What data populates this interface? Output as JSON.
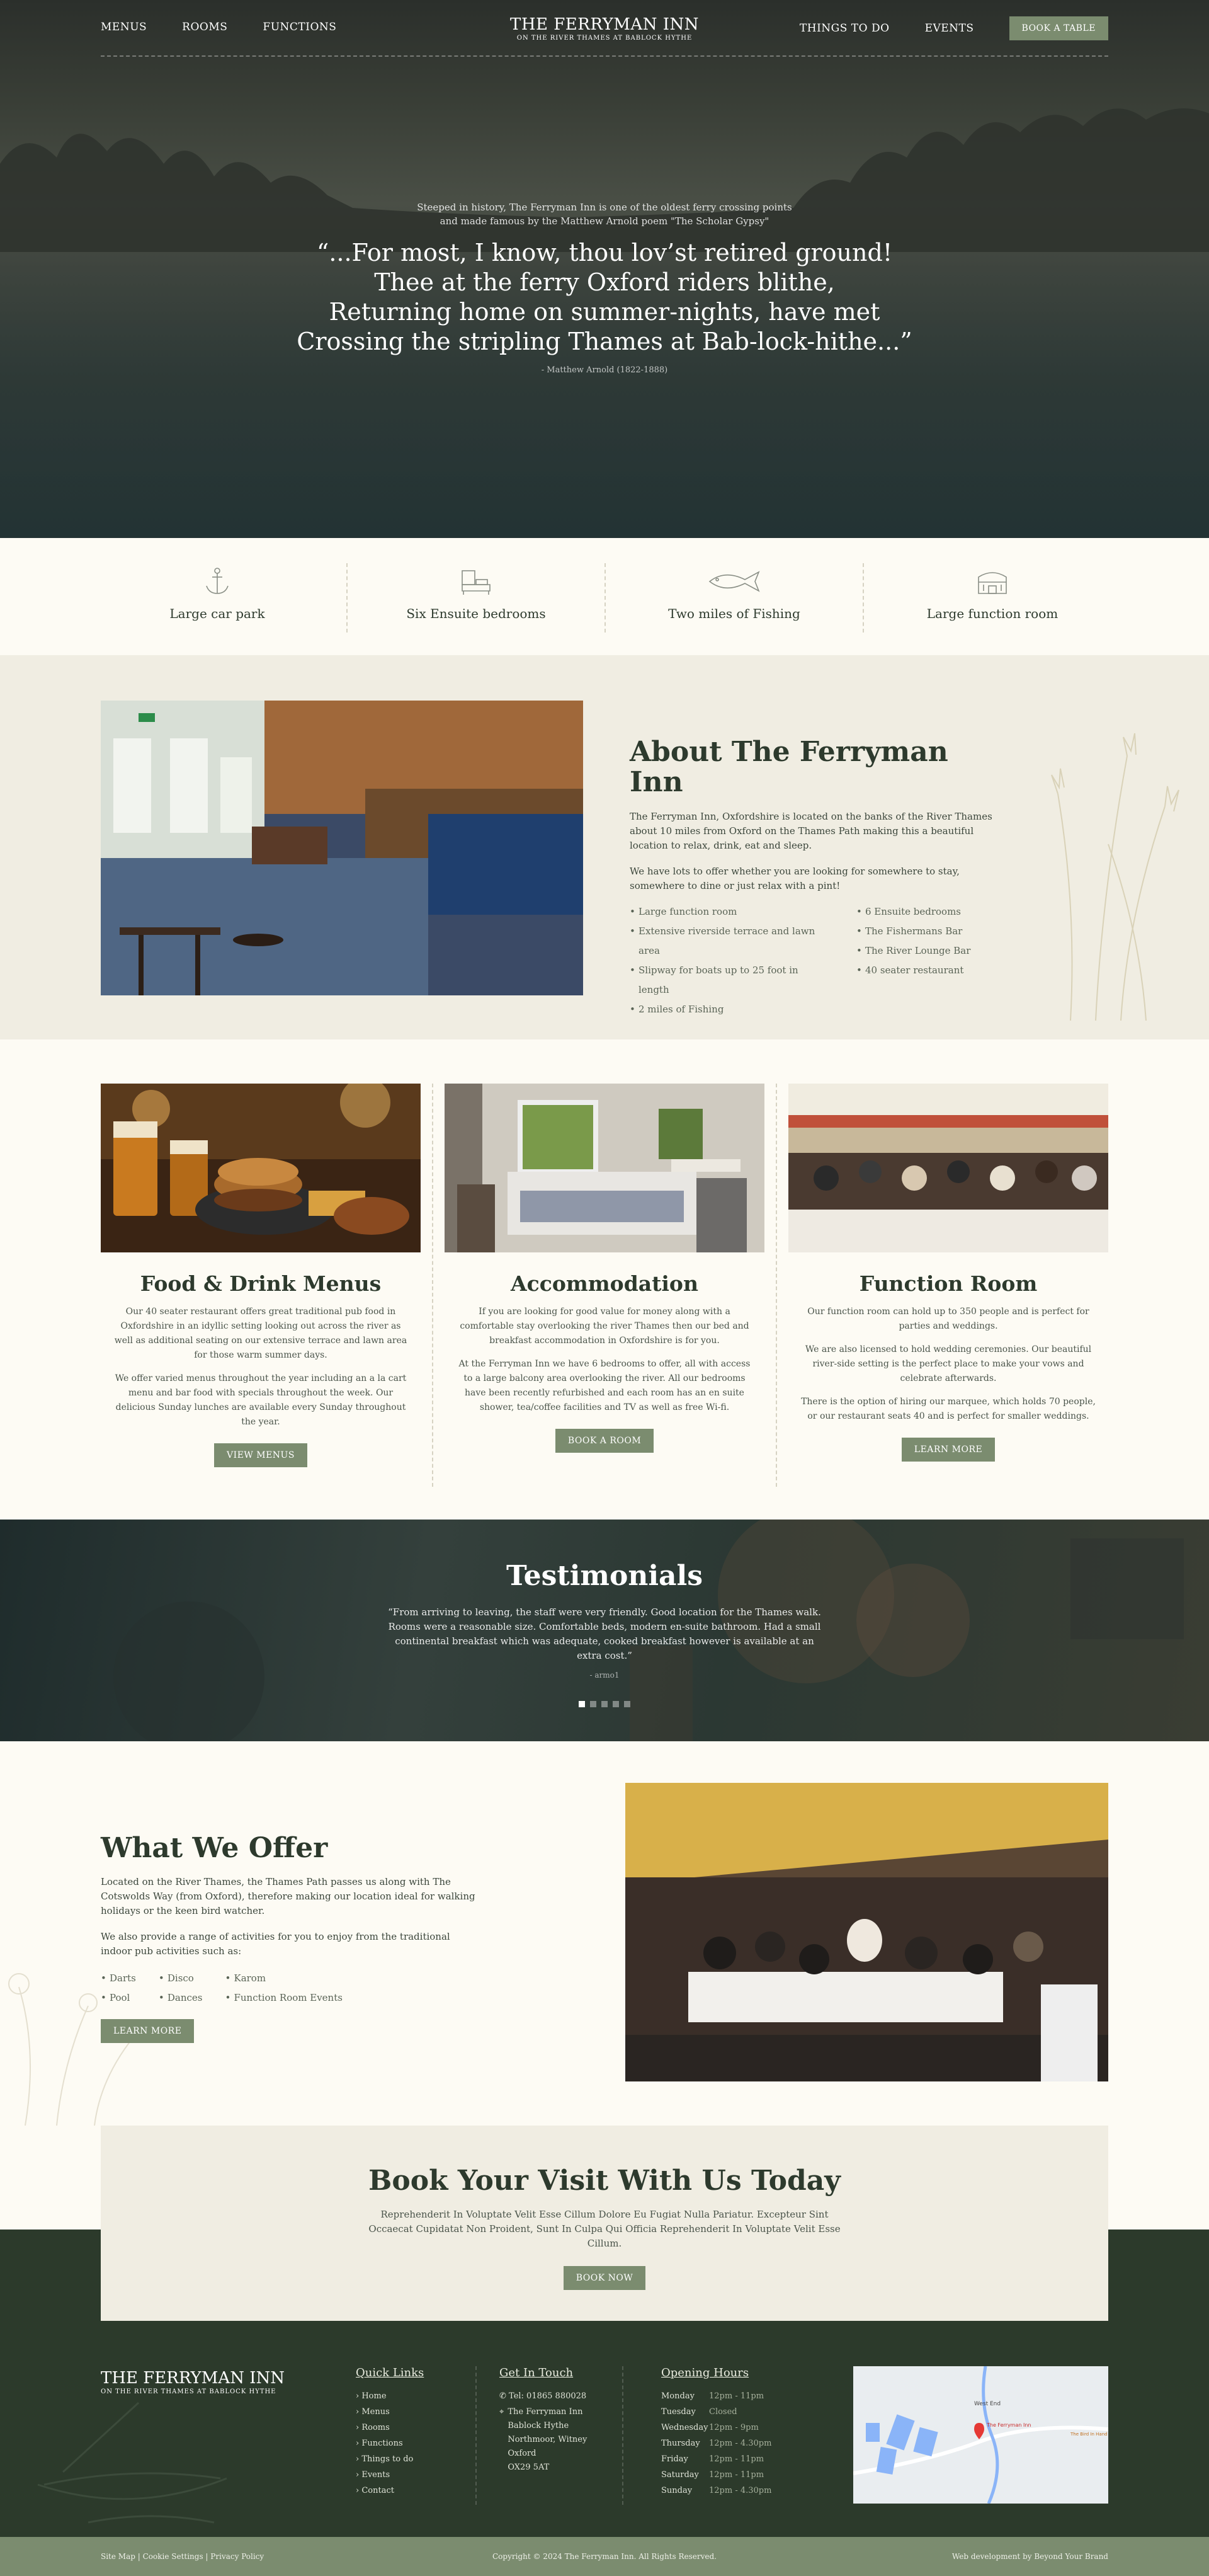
{
  "nav": {
    "left": [
      "MENUS",
      "ROOMS",
      "FUNCTIONS"
    ],
    "right": [
      "THINGS TO DO",
      "EVENTS"
    ],
    "book_button": "BOOK A TABLE",
    "logo_name": "THE FERRYMAN INN",
    "logo_sub": "ON THE RIVER THAMES AT BABLOCK HYTHE"
  },
  "hero": {
    "intro": "Steeped in history, The Ferryman Inn is one of the oldest ferry crossing points and made famous by the Matthew Arnold poem \"The Scholar Gypsy\"",
    "quote_lines": [
      "“...For most, I know, thou lov’st retired ground!",
      "Thee at the ferry Oxford riders blithe,",
      "Returning home on summer-nights, have met",
      "Crossing the stripling Thames at Bab-lock-hithe...”"
    ],
    "cite": "- Matthew Arnold (1822-1888)"
  },
  "features": [
    {
      "label": "Large car park",
      "icon": "anchor-icon"
    },
    {
      "label": "Six Ensuite bedrooms",
      "icon": "bed-icon"
    },
    {
      "label": "Two miles of Fishing",
      "icon": "fish-icon"
    },
    {
      "label": "Large function room",
      "icon": "building-icon"
    }
  ],
  "about": {
    "title": "About The Ferryman Inn",
    "p1": "The Ferryman Inn, Oxfordshire is located on the banks of the River Thames about 10 miles from Oxford on the Thames Path making this a beautiful location to relax, drink, eat and sleep.",
    "p2": "We have lots to offer whether you are looking for somewhere to stay, somewhere to dine or just relax with a pint!",
    "list_left": [
      "Large function room",
      "Extensive riverside terrace and lawn area",
      "Slipway for boats up to 25 foot in length",
      "2 miles of Fishing"
    ],
    "list_right": [
      "6 Ensuite bedrooms",
      "The Fishermans Bar",
      "The River Lounge Bar",
      "40 seater restaurant"
    ]
  },
  "cards": [
    {
      "title": "Food & Drink Menus",
      "p1": "Our 40 seater restaurant offers great traditional pub food in Oxfordshire in an idyllic setting looking out across the river as well as additional seating on our extensive terrace and lawn area for those warm summer days.",
      "p2": "We offer varied menus throughout the year including an a la cart menu and bar food with specials throughout the week. Our delicious Sunday lunches are available every Sunday throughout the year.",
      "button": "VIEW MENUS"
    },
    {
      "title": "Accommodation",
      "p1": "If you are looking for good value for money along with a comfortable stay overlooking the river Thames then our bed and breakfast accommodation in Oxfordshire is for you.",
      "p2": "At the Ferryman Inn we have 6 bedrooms to offer, all with access to a large balcony area overlooking the river. All our bedrooms have been recently refurbished and each room has an en  suite shower, tea/coffee facilities and TV as well as free Wi-fi.",
      "button": "BOOK A ROOM"
    },
    {
      "title": "Function Room",
      "p1": "Our function room can hold up to 350 people and is perfect for parties and weddings.",
      "p2": "We are also licensed to hold wedding ceremonies. Our beautiful river-side setting is the perfect place to make your vows and celebrate afterwards.",
      "p3": "There is the option of hiring our marquee, which holds 70 people, or  our restaurant seats 40 and is perfect for smaller weddings.",
      "button": "LEARN MORE"
    }
  ],
  "testimonials": {
    "title": "Testimonials",
    "quote": "“From arriving to leaving, the staff were very friendly. Good location for the Thames walk. Rooms were a reasonable size. Comfortable beds, modern en-suite bathroom. Had a small continental breakfast which was adequate, cooked breakfast however is available at an extra cost.”",
    "author": "- armo1",
    "slides": 5,
    "active": 0
  },
  "offer": {
    "title": "What We Offer",
    "p1": "Located on the River Thames, the Thames Path passes us along with The  Cotswolds Way (from Oxford), therefore making our location ideal for walking holidays or the keen bird watcher.",
    "p2": "We also provide a range of activities for you to enjoy from the traditional indoor pub activities such as:",
    "col1": [
      "Darts",
      "Pool"
    ],
    "col2": [
      "Disco",
      "Dances"
    ],
    "col3": [
      "Karom",
      "Function Room Events"
    ],
    "button": "LEARN MORE"
  },
  "book": {
    "title": "Book Your Visit With Us Today",
    "text": "Reprehenderit In Voluptate Velit Esse Cillum Dolore Eu Fugiat Nulla Pariatur. Excepteur Sint Occaecat Cupidatat Non Proident, Sunt In Culpa Qui Officia Reprehenderit In Voluptate Velit Esse Cillum.",
    "button": "BOOK NOW"
  },
  "footer": {
    "logo_name": "THE FERRYMAN INN",
    "logo_sub": "ON THE RIVER THAMES AT BABLOCK HYTHE",
    "quick_title": "Quick Links",
    "quick_links": [
      "Home",
      "Menus",
      "Rooms",
      "Functions",
      "Things to do",
      "Events",
      "Contact"
    ],
    "touch_title": "Get In Touch",
    "phone": "Tel: 01865 880028",
    "address": [
      "The Ferryman Inn",
      "Bablock Hythe",
      "Northmoor, Witney",
      "Oxford",
      "OX29 5AT"
    ],
    "hours_title": "Opening Hours",
    "hours": [
      {
        "day": "Monday",
        "time": "12pm - 11pm"
      },
      {
        "day": "Tuesday",
        "time": "Closed"
      },
      {
        "day": "Wednesday",
        "time": "12pm - 9pm"
      },
      {
        "day": "Thursday",
        "time": "12pm - 4.30pm"
      },
      {
        "day": "Friday",
        "time": "12pm - 11pm"
      },
      {
        "day": "Saturday",
        "time": "12pm - 11pm"
      },
      {
        "day": "Sunday",
        "time": "12pm - 4.30pm"
      }
    ],
    "map_labels": [
      "West End",
      "The Ferryman Inn",
      "The Bird In Hand"
    ],
    "bottom_left": "Site Map  |  Cookie Settings  |  Privacy Policy",
    "copyright": "Copyright © 2024 The Ferryman Inn. All Rights Reserved.",
    "credit": "Web development by Beyond Your Brand"
  },
  "colors": {
    "accent": "#7b8c6f",
    "dark_green": "#2c3a2b",
    "cream": "#fdfbf4",
    "sand": "#f0ede2"
  }
}
